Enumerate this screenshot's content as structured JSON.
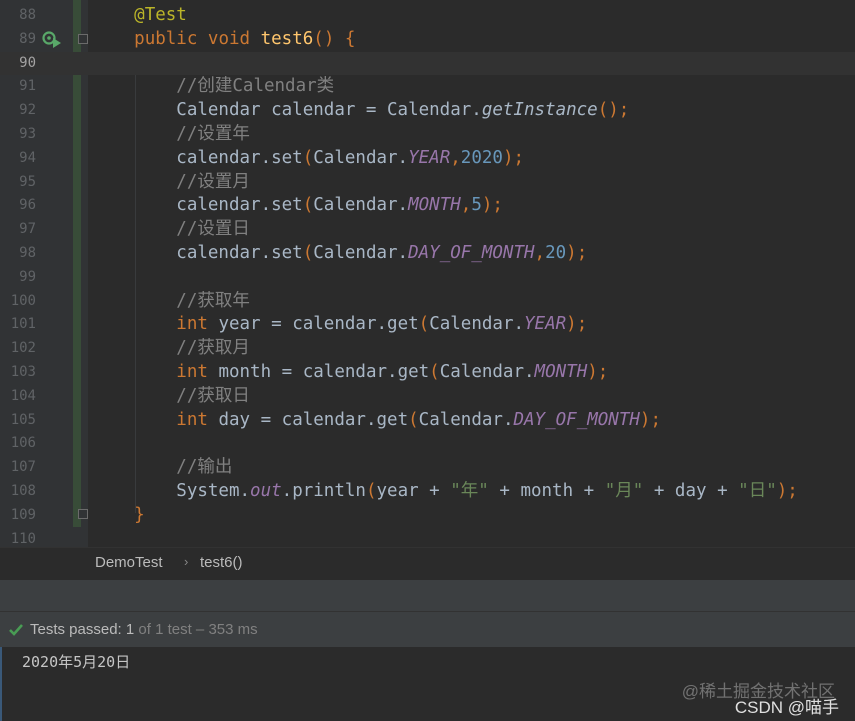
{
  "editor": {
    "lines": [
      {
        "num": "88",
        "tokens": [
          {
            "t": "    ",
            "c": ""
          },
          {
            "t": "@Test",
            "c": "ann"
          }
        ]
      },
      {
        "num": "89",
        "tokens": [
          {
            "t": "    ",
            "c": ""
          },
          {
            "t": "public ",
            "c": "kw"
          },
          {
            "t": "void ",
            "c": "kw"
          },
          {
            "t": "test6",
            "c": "fn"
          },
          {
            "t": "() {",
            "c": "punc"
          }
        ]
      },
      {
        "num": "90",
        "current": true,
        "tokens": []
      },
      {
        "num": "91",
        "tokens": [
          {
            "t": "        ",
            "c": ""
          },
          {
            "t": "//创建Calendar类",
            "c": "cm"
          }
        ]
      },
      {
        "num": "92",
        "tokens": [
          {
            "t": "        Calendar calendar = Calendar.",
            "c": ""
          },
          {
            "t": "getInstance",
            "c": "ital"
          },
          {
            "t": "();",
            "c": "punc"
          }
        ]
      },
      {
        "num": "93",
        "tokens": [
          {
            "t": "        ",
            "c": ""
          },
          {
            "t": "//设置年",
            "c": "cm"
          }
        ]
      },
      {
        "num": "94",
        "tokens": [
          {
            "t": "        calendar.set",
            "c": ""
          },
          {
            "t": "(",
            "c": "punc"
          },
          {
            "t": "Calendar.",
            "c": ""
          },
          {
            "t": "YEAR",
            "c": "fld"
          },
          {
            "t": ",",
            "c": "punc"
          },
          {
            "t": "2020",
            "c": "num"
          },
          {
            "t": ");",
            "c": "punc"
          }
        ]
      },
      {
        "num": "95",
        "tokens": [
          {
            "t": "        ",
            "c": ""
          },
          {
            "t": "//设置月",
            "c": "cm"
          }
        ]
      },
      {
        "num": "96",
        "tokens": [
          {
            "t": "        calendar.set",
            "c": ""
          },
          {
            "t": "(",
            "c": "punc"
          },
          {
            "t": "Calendar.",
            "c": ""
          },
          {
            "t": "MONTH",
            "c": "fld"
          },
          {
            "t": ",",
            "c": "punc"
          },
          {
            "t": "5",
            "c": "num"
          },
          {
            "t": ");",
            "c": "punc"
          }
        ]
      },
      {
        "num": "97",
        "tokens": [
          {
            "t": "        ",
            "c": ""
          },
          {
            "t": "//设置日",
            "c": "cm"
          }
        ]
      },
      {
        "num": "98",
        "tokens": [
          {
            "t": "        calendar.set",
            "c": ""
          },
          {
            "t": "(",
            "c": "punc"
          },
          {
            "t": "Calendar.",
            "c": ""
          },
          {
            "t": "DAY_OF_MONTH",
            "c": "fld"
          },
          {
            "t": ",",
            "c": "punc"
          },
          {
            "t": "20",
            "c": "num"
          },
          {
            "t": ");",
            "c": "punc"
          }
        ]
      },
      {
        "num": "99",
        "tokens": []
      },
      {
        "num": "100",
        "tokens": [
          {
            "t": "        ",
            "c": ""
          },
          {
            "t": "//获取年",
            "c": "cm"
          }
        ]
      },
      {
        "num": "101",
        "tokens": [
          {
            "t": "        ",
            "c": ""
          },
          {
            "t": "int ",
            "c": "kw"
          },
          {
            "t": "year = calendar.get",
            "c": ""
          },
          {
            "t": "(",
            "c": "punc"
          },
          {
            "t": "Calendar.",
            "c": ""
          },
          {
            "t": "YEAR",
            "c": "fld"
          },
          {
            "t": ");",
            "c": "punc"
          }
        ]
      },
      {
        "num": "102",
        "tokens": [
          {
            "t": "        ",
            "c": ""
          },
          {
            "t": "//获取月",
            "c": "cm"
          }
        ]
      },
      {
        "num": "103",
        "tokens": [
          {
            "t": "        ",
            "c": ""
          },
          {
            "t": "int ",
            "c": "kw"
          },
          {
            "t": "month = calendar.get",
            "c": ""
          },
          {
            "t": "(",
            "c": "punc"
          },
          {
            "t": "Calendar.",
            "c": ""
          },
          {
            "t": "MONTH",
            "c": "fld"
          },
          {
            "t": ");",
            "c": "punc"
          }
        ]
      },
      {
        "num": "104",
        "tokens": [
          {
            "t": "        ",
            "c": ""
          },
          {
            "t": "//获取日",
            "c": "cm"
          }
        ]
      },
      {
        "num": "105",
        "tokens": [
          {
            "t": "        ",
            "c": ""
          },
          {
            "t": "int ",
            "c": "kw"
          },
          {
            "t": "day = calendar.get",
            "c": ""
          },
          {
            "t": "(",
            "c": "punc"
          },
          {
            "t": "Calendar.",
            "c": ""
          },
          {
            "t": "DAY_OF_MONTH",
            "c": "fld"
          },
          {
            "t": ");",
            "c": "punc"
          }
        ]
      },
      {
        "num": "106",
        "tokens": []
      },
      {
        "num": "107",
        "tokens": [
          {
            "t": "        ",
            "c": ""
          },
          {
            "t": "//输出",
            "c": "cm"
          }
        ]
      },
      {
        "num": "108",
        "tokens": [
          {
            "t": "        System.",
            "c": ""
          },
          {
            "t": "out",
            "c": "fld"
          },
          {
            "t": ".println",
            "c": ""
          },
          {
            "t": "(",
            "c": "punc"
          },
          {
            "t": "year + ",
            "c": ""
          },
          {
            "t": "\"年\"",
            "c": "str"
          },
          {
            "t": " + month + ",
            "c": ""
          },
          {
            "t": "\"月\"",
            "c": "str"
          },
          {
            "t": " + day + ",
            "c": ""
          },
          {
            "t": "\"日\"",
            "c": "str"
          },
          {
            "t": ");",
            "c": "punc"
          }
        ]
      },
      {
        "num": "109",
        "tokens": [
          {
            "t": "    ",
            "c": ""
          },
          {
            "t": "}",
            "c": "punc"
          }
        ]
      },
      {
        "num": "110",
        "tokens": []
      }
    ]
  },
  "breadcrumb": {
    "class_name": "DemoTest",
    "separator": "›",
    "method_name": "test6()"
  },
  "run_status": {
    "label": "Tests passed: ",
    "passed": "1",
    "detail": " of 1 test – 353 ms"
  },
  "console": {
    "output": "2020年5月20日"
  },
  "watermark": {
    "line1": "@稀土掘金技术社区",
    "line2": "CSDN @喵手"
  },
  "icons": {
    "run": "run-test-icon",
    "fold": "fold-marker-icon",
    "check": "check-icon"
  },
  "colors": {
    "editor_bg": "#2b2b2b",
    "keyword": "#cc7832",
    "annotation": "#bbb529",
    "method": "#ffc66d",
    "comment": "#808080",
    "number": "#6897bb",
    "string": "#6a8759",
    "field": "#9876aa",
    "pass_green": "#499c54"
  }
}
